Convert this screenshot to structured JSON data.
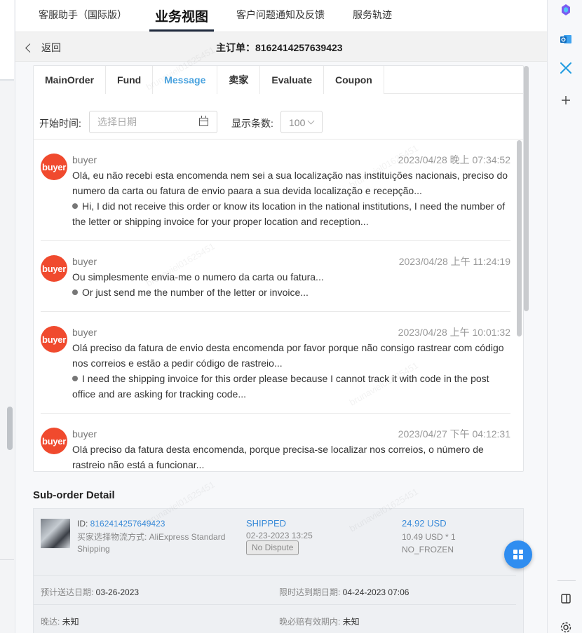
{
  "top_tabs": [
    {
      "label": "客服助手（国际版）"
    },
    {
      "label": "业务视图"
    },
    {
      "label": "客户问题通知及反馈"
    },
    {
      "label": "服务轨迹"
    }
  ],
  "order_bar": {
    "back_label": "返回",
    "title": "主订单：8162414257639423"
  },
  "sub_tabs": [
    {
      "label": "MainOrder"
    },
    {
      "label": "Fund"
    },
    {
      "label": "Message"
    },
    {
      "label": "卖家"
    },
    {
      "label": "Evaluate"
    },
    {
      "label": "Coupon"
    }
  ],
  "filter": {
    "start_label": "开始时间:",
    "date_placeholder": "选择日期",
    "count_label": "显示条数:",
    "count_value": "100"
  },
  "messages": [
    {
      "avatar": "buyer",
      "sender": "buyer",
      "time": "2023/04/28 晚上 07:34:52",
      "text": "Olá, eu não recebi esta encomenda nem sei a sua localização nas instituições nacionais, preciso do numero da carta ou fatura de envio paara a sua devida localização e recepção...",
      "translation": "Hi, I did not receive this order or know its location in the national institutions, I need the number of the letter or shipping invoice for your proper location and reception..."
    },
    {
      "avatar": "buyer",
      "sender": "buyer",
      "time": "2023/04/28 上午 11:24:19",
      "text": "Ou simplesmente envia-me o numero da carta ou fatura...",
      "translation": "Or just send me the number of the letter or invoice..."
    },
    {
      "avatar": "buyer",
      "sender": "buyer",
      "time": "2023/04/28 上午 10:01:32",
      "text": "Olá preciso da fatura de envio desta encomenda por favor porque não consigo rastrear com código nos correios e estão a pedir código de rastreio...",
      "translation": "I need the shipping invoice for this order please because I cannot track it with code in the post office and are asking for tracking code..."
    },
    {
      "avatar": "buyer",
      "sender": "buyer",
      "time": "2023/04/27 下午 04:12:31",
      "text": "Olá preciso da fatura desta encomenda, porque precisa-se localizar nos correios, o número de rastreio não está a funcionar...",
      "translation": ""
    }
  ],
  "suborder": {
    "section_title": "Sub-order Detail",
    "id_label": "ID: ",
    "id": "8162414257649423",
    "shipping": "买家选择物流方式:  AliExpress Standard Shipping",
    "status": "SHIPPED",
    "status_date": "02-23-2023 13:25",
    "dispute": "No Dispute",
    "amount": "24.92 USD",
    "unit": "10.49 USD * 1",
    "frozen": "NO_FROZEN",
    "eta_label": "预计送达日期: ",
    "eta": "03-26-2023",
    "deadline_label": "限时达到期日期: ",
    "deadline": "04-24-2023 07:06",
    "late_label": "晚达: ",
    "late": "未知",
    "comp_label": "晚必赔有效期内: ",
    "comp": "未知"
  },
  "watermark": "brunaviel01625451",
  "colors": {
    "accent": "#4aa3df",
    "avatar": "#f04a2e",
    "fab": "#2f8df0"
  },
  "icons": {
    "rail": [
      "copilot-icon",
      "outlook-icon",
      "tools-icon",
      "plus-icon",
      "sidebar-toggle-icon",
      "settings-icon"
    ],
    "fab": "grid-icon"
  }
}
